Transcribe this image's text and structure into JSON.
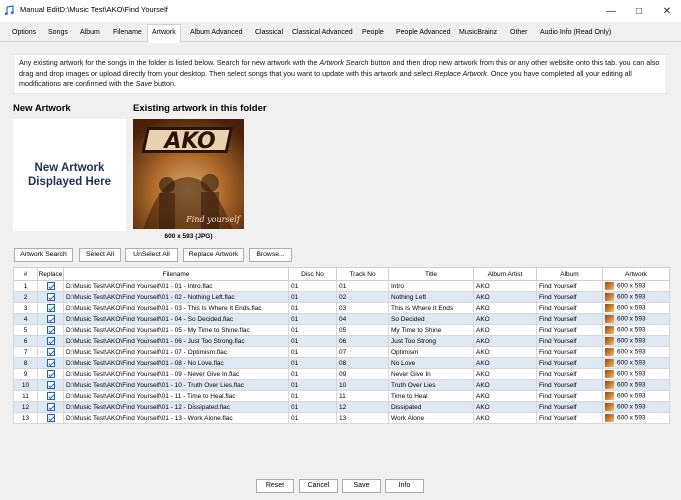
{
  "window": {
    "title": "Manual EditD:\\Music Test\\AKO\\Find Yourself",
    "minimize_glyph": "—",
    "maximize_glyph": "□",
    "close_glyph": "✕"
  },
  "tabs": [
    {
      "label": "Options"
    },
    {
      "label": "Songs"
    },
    {
      "label": "Album"
    },
    {
      "label": "Filename"
    },
    {
      "label": "Artwork",
      "active": true
    },
    {
      "label": "Album Advanced"
    },
    {
      "label": "Classical"
    },
    {
      "label": "Classical Advanced"
    },
    {
      "label": "People"
    },
    {
      "label": "People Advanced"
    },
    {
      "label": "MusicBrainz"
    },
    {
      "label": "Other"
    },
    {
      "label": "Audio Info (Read Only)"
    }
  ],
  "info": {
    "part1": "Any existing artwork for the songs in the folder is listed below. Search for new artwork with the ",
    "artwork_search": "Artwork Search",
    "part2": " button and then drop new artwork from this or any other website onto this tab. you can also drag and drop images or upload directly from your desktop. Then select songs that you want to update with this artwork and select ",
    "replace_artwork": "Replace Artwork",
    "part3": ". Once you have completed all your editing all modifications are confirmed with the ",
    "save": "Save",
    "part4": " button."
  },
  "new_artwork": {
    "heading": "New Artwork",
    "placeholder_line1": "New Artwork",
    "placeholder_line2": "Displayed Here"
  },
  "existing_artwork": {
    "heading": "Existing artwork in this folder",
    "cover_text": "AKO",
    "cover_subtext": "Find yourself",
    "caption": "600 x 593 (JPG)"
  },
  "buttons": {
    "artwork_search": "Artwork Search",
    "select_all": "Select All",
    "unselect_all": "UnSelect All",
    "replace_artwork": "Replace Artwork",
    "browse": "Browse..."
  },
  "table": {
    "columns": [
      "#",
      "Replace",
      "Filename",
      "Disc No",
      "Track No",
      "Title",
      "Album Artist",
      "Album",
      "Artwork"
    ],
    "rows": [
      {
        "n": "1",
        "file": "D:\\Music Test\\AKO\\Find Yourself\\01 - 01 - Intro.flac",
        "disc": "01",
        "track": "01",
        "title": "Intro",
        "artist": "AKO",
        "album": "Find Yourself",
        "art": "600 x 593"
      },
      {
        "n": "2",
        "file": "D:\\Music Test\\AKO\\Find Yourself\\01 - 02 - Nothing Left.flac",
        "disc": "01",
        "track": "02",
        "title": "Nothing Left",
        "artist": "AKO",
        "album": "Find Yourself",
        "art": "600 x 593"
      },
      {
        "n": "3",
        "file": "D:\\Music Test\\AKO\\Find Yourself\\01 - 03 - This Is Where It Ends.flac",
        "disc": "01",
        "track": "03",
        "title": "This Is Where It Ends",
        "artist": "AKO",
        "album": "Find Yourself",
        "art": "600 x 593"
      },
      {
        "n": "4",
        "file": "D:\\Music Test\\AKO\\Find Yourself\\01 - 04 - So Decided.flac",
        "disc": "01",
        "track": "04",
        "title": "So Decided",
        "artist": "AKO",
        "album": "Find Yourself",
        "art": "600 x 593"
      },
      {
        "n": "5",
        "file": "D:\\Music Test\\AKO\\Find Yourself\\01 - 05 - My Time to Shine.flac",
        "disc": "01",
        "track": "05",
        "title": "My Time to Shine",
        "artist": "AKO",
        "album": "Find Yourself",
        "art": "600 x 593"
      },
      {
        "n": "6",
        "file": "D:\\Music Test\\AKO\\Find Yourself\\01 - 06 - Just Too Strong.flac",
        "disc": "01",
        "track": "06",
        "title": "Just Too Strong",
        "artist": "AKO",
        "album": "Find Yourself",
        "art": "600 x 593"
      },
      {
        "n": "7",
        "file": "D:\\Music Test\\AKO\\Find Yourself\\01 - 07 - Optimism.flac",
        "disc": "01",
        "track": "07",
        "title": "Optimism",
        "artist": "AKO",
        "album": "Find Yourself",
        "art": "600 x 593"
      },
      {
        "n": "8",
        "file": "D:\\Music Test\\AKO\\Find Yourself\\01 - 08 - No Love.flac",
        "disc": "01",
        "track": "08",
        "title": "No Love",
        "artist": "AKO",
        "album": "Find Yourself",
        "art": "600 x 593"
      },
      {
        "n": "9",
        "file": "D:\\Music Test\\AKO\\Find Yourself\\01 - 09 - Never Give In.flac",
        "disc": "01",
        "track": "09",
        "title": "Never Give In",
        "artist": "AKO",
        "album": "Find Yourself",
        "art": "600 x 593"
      },
      {
        "n": "10",
        "file": "D:\\Music Test\\AKO\\Find Yourself\\01 - 10 - Truth Over Lies.flac",
        "disc": "01",
        "track": "10",
        "title": "Truth Over Lies",
        "artist": "AKO",
        "album": "Find Yourself",
        "art": "600 x 593"
      },
      {
        "n": "11",
        "file": "D:\\Music Test\\AKO\\Find Yourself\\01 - 11 - Time to Heal.flac",
        "disc": "01",
        "track": "11",
        "title": "Time to Heal",
        "artist": "AKO",
        "album": "Find Yourself",
        "art": "600 x 593"
      },
      {
        "n": "12",
        "file": "D:\\Music Test\\AKO\\Find Yourself\\01 - 12 - Dissipated.flac",
        "disc": "01",
        "track": "12",
        "title": "Dissipated",
        "artist": "AKO",
        "album": "Find Yourself",
        "art": "600 x 593"
      },
      {
        "n": "13",
        "file": "D:\\Music Test\\AKO\\Find Yourself\\01 - 13 - Work Alone.flac",
        "disc": "01",
        "track": "13",
        "title": "Work Alone",
        "artist": "AKO",
        "album": "Find Yourself",
        "art": "600 x 593"
      }
    ]
  },
  "footer": {
    "reset": "Reset",
    "cancel": "Cancel",
    "save": "Save",
    "info": "Info"
  }
}
